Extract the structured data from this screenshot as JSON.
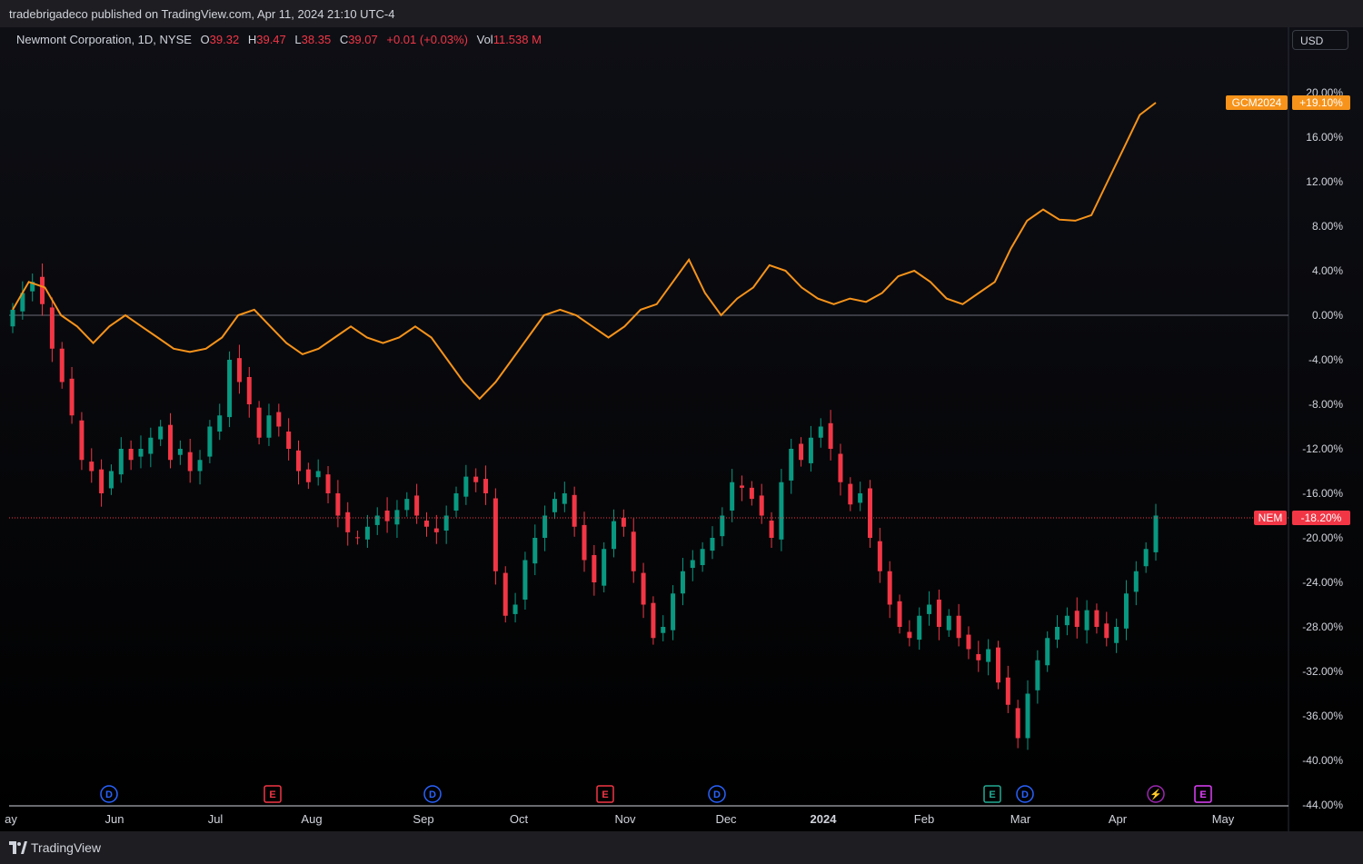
{
  "header": {
    "publisher": "tradebrigadeco published on TradingView.com, Apr 11, 2024 21:10 UTC-4"
  },
  "legend": {
    "symbol": "Newmont Corporation, 1D, NYSE",
    "o_label": "O",
    "o_value": "39.32",
    "h_label": "H",
    "h_value": "39.47",
    "l_label": "L",
    "l_value": "38.35",
    "c_label": "C",
    "c_value": "39.07",
    "change": "+0.01 (+0.03%)",
    "vol_label": "Vol",
    "vol_value": "11.538 M"
  },
  "currency_button": "USD",
  "colors": {
    "up": "#089981",
    "down": "#f23645",
    "compare_line": "#f7931a",
    "grid": "#1c1f27",
    "axis_text": "#d1d4dc"
  },
  "footer": {
    "brand": "TradingView",
    "logo_icon": "tradingview-logo-icon"
  },
  "chart_data": {
    "type": "line",
    "subtype": "candlestick-with-compare-overlay",
    "scale": "percent",
    "ylim": [
      -44,
      22
    ],
    "y_ticks": [
      "20.00%",
      "16.00%",
      "12.00%",
      "8.00%",
      "4.00%",
      "0.00%",
      "-4.00%",
      "-8.00%",
      "-12.00%",
      "-16.00%",
      "-20.00%",
      "-24.00%",
      "-28.00%",
      "-32.00%",
      "-36.00%",
      "-40.00%",
      "-44.00%"
    ],
    "x_ticks": [
      "ay",
      "Jun",
      "Jul",
      "Aug",
      "Sep",
      "Oct",
      "Nov",
      "Dec",
      "2024",
      "Feb",
      "Mar",
      "Apr",
      "May"
    ],
    "x_tick_bold": [
      "2024"
    ],
    "series": [
      {
        "name": "GCM2024",
        "style": "line",
        "color": "#f7931a",
        "last_label": "+19.10%",
        "points": [
          [
            0,
            0.5
          ],
          [
            3,
            3
          ],
          [
            6,
            2.5
          ],
          [
            9,
            0
          ],
          [
            12,
            -1
          ],
          [
            15,
            -2.5
          ],
          [
            18,
            -1
          ],
          [
            21,
            0
          ],
          [
            24,
            -1
          ],
          [
            27,
            -2
          ],
          [
            30,
            -3
          ],
          [
            33,
            -3.3
          ],
          [
            36,
            -3
          ],
          [
            39,
            -2
          ],
          [
            42,
            0
          ],
          [
            45,
            0.5
          ],
          [
            48,
            -1
          ],
          [
            51,
            -2.5
          ],
          [
            54,
            -3.5
          ],
          [
            57,
            -3
          ],
          [
            60,
            -2
          ],
          [
            63,
            -1
          ],
          [
            66,
            -2
          ],
          [
            69,
            -2.5
          ],
          [
            72,
            -2
          ],
          [
            75,
            -1
          ],
          [
            78,
            -2
          ],
          [
            81,
            -4
          ],
          [
            84,
            -6
          ],
          [
            87,
            -7.5
          ],
          [
            90,
            -6
          ],
          [
            93,
            -4
          ],
          [
            96,
            -2
          ],
          [
            99,
            0
          ],
          [
            102,
            0.5
          ],
          [
            105,
            0
          ],
          [
            108,
            -1
          ],
          [
            111,
            -2
          ],
          [
            114,
            -1
          ],
          [
            117,
            0.5
          ],
          [
            120,
            1
          ],
          [
            123,
            3
          ],
          [
            126,
            5
          ],
          [
            129,
            2
          ],
          [
            132,
            0
          ],
          [
            135,
            1.5
          ],
          [
            138,
            2.5
          ],
          [
            141,
            4.5
          ],
          [
            144,
            4
          ],
          [
            147,
            2.5
          ],
          [
            150,
            1.5
          ],
          [
            153,
            1
          ],
          [
            156,
            1.5
          ],
          [
            159,
            1.2
          ],
          [
            162,
            2
          ],
          [
            165,
            3.5
          ],
          [
            168,
            4
          ],
          [
            171,
            3
          ],
          [
            174,
            1.5
          ],
          [
            177,
            1
          ],
          [
            180,
            2
          ],
          [
            183,
            3
          ],
          [
            186,
            6
          ],
          [
            189,
            8.5
          ],
          [
            192,
            9.5
          ],
          [
            195,
            8.6
          ],
          [
            198,
            8.5
          ],
          [
            201,
            9
          ],
          [
            204,
            12
          ],
          [
            207,
            15
          ],
          [
            210,
            18
          ],
          [
            213,
            19.1
          ]
        ]
      },
      {
        "name": "NEM",
        "style": "candlestick",
        "last_label": "-18.20%",
        "closes": [
          0.5,
          2,
          3,
          1,
          -3,
          -6,
          -9,
          -13,
          -14,
          -16,
          -14,
          -12,
          -13,
          -12,
          -11,
          -10,
          -13,
          -12,
          -14,
          -13,
          -10,
          -9,
          -4,
          -6,
          -8,
          -11,
          -9,
          -10,
          -12,
          -14,
          -15,
          -14,
          -16,
          -18,
          -19.5,
          -20,
          -19,
          -18,
          -18.5,
          -17.5,
          -16.5,
          -18,
          -19,
          -19.5,
          -18,
          -16,
          -14.5,
          -15,
          -16,
          -23,
          -27,
          -26,
          -22,
          -20,
          -18,
          -16.5,
          -16,
          -19,
          -22,
          -24,
          -21,
          -18.5,
          -19,
          -23,
          -26,
          -29,
          -28,
          -25,
          -23,
          -22,
          -21,
          -20,
          -18,
          -15,
          -15.5,
          -16.5,
          -18,
          -20,
          -15,
          -12,
          -13,
          -11,
          -10,
          -12,
          -15,
          -17,
          -16,
          -20,
          -23,
          -26,
          -28,
          -29,
          -27,
          -26,
          -28,
          -27,
          -29,
          -30,
          -31,
          -30,
          -33,
          -35,
          -38,
          -34,
          -31,
          -29,
          -28,
          -27,
          -28,
          -26.5,
          -28,
          -29,
          -28,
          -25,
          -23,
          -21,
          -18
        ]
      }
    ],
    "event_markers": [
      {
        "label": "D",
        "kind": "dividend",
        "month": "Jun"
      },
      {
        "label": "E",
        "kind": "earnings",
        "month": "Jul"
      },
      {
        "label": "D",
        "kind": "dividend",
        "month": "Sep"
      },
      {
        "label": "E",
        "kind": "earnings",
        "month": "Oct"
      },
      {
        "label": "D",
        "kind": "dividend",
        "month": "Nov"
      },
      {
        "label": "E",
        "kind": "earnings",
        "month": "Feb"
      },
      {
        "label": "D",
        "kind": "dividend",
        "month": "Feb"
      },
      {
        "label": "⚡",
        "kind": "split",
        "month": "Apr"
      },
      {
        "label": "E",
        "kind": "earnings",
        "month": "Apr"
      }
    ]
  }
}
